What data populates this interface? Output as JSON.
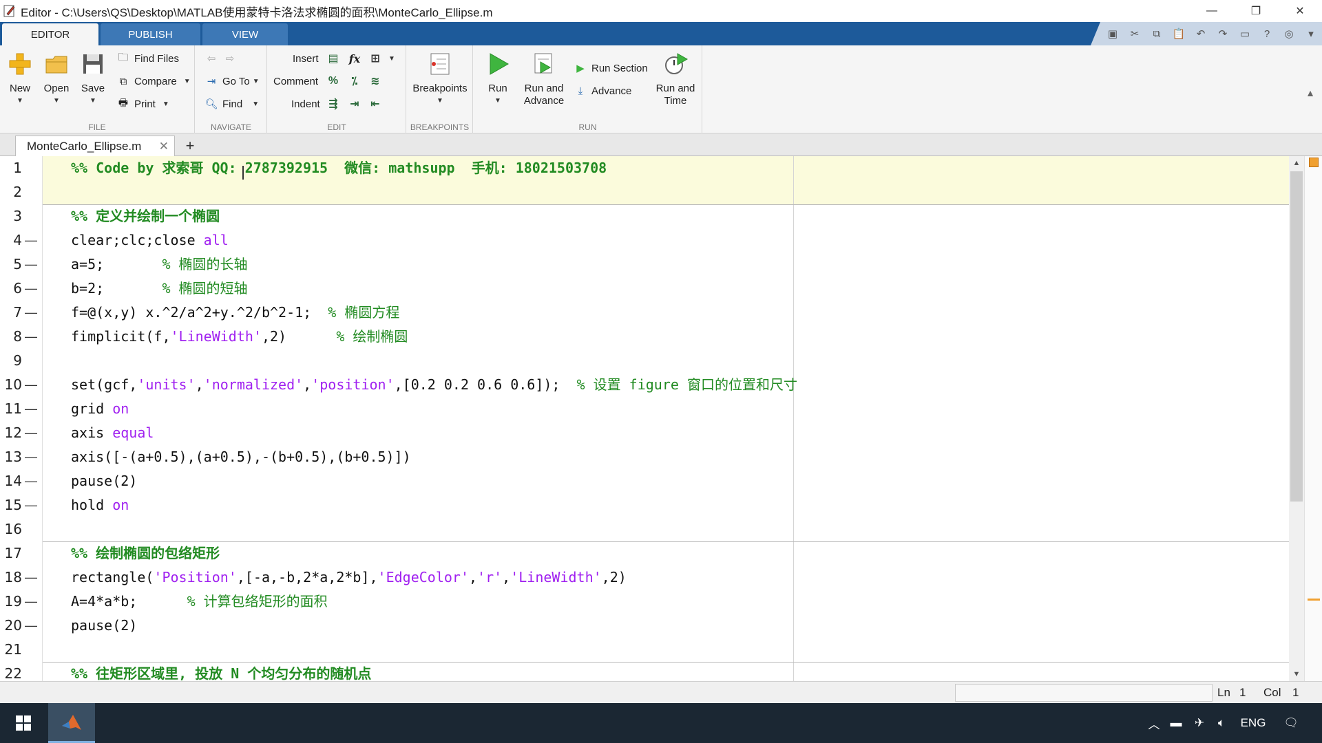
{
  "window": {
    "title": "Editor - C:\\Users\\QS\\Desktop\\MATLAB使用蒙特卡洛法求椭圆的面积\\MonteCarlo_Ellipse.m",
    "minimize": "—",
    "restore": "❐",
    "close": "✕"
  },
  "ribbon_tabs": [
    "EDITOR",
    "PUBLISH",
    "VIEW"
  ],
  "ribbon": {
    "file": {
      "label": "FILE",
      "new": "New",
      "open": "Open",
      "save": "Save",
      "find_files": "Find Files",
      "compare": "Compare",
      "print": "Print"
    },
    "navigate": {
      "label": "NAVIGATE",
      "goto": "Go To",
      "find": "Find"
    },
    "edit": {
      "label": "EDIT",
      "insert": "Insert",
      "comment": "Comment",
      "indent": "Indent",
      "fx": "fx"
    },
    "breakpoints": {
      "label": "BREAKPOINTS",
      "breakpoints": "Breakpoints"
    },
    "run": {
      "label": "RUN",
      "run": "Run",
      "run_and_advance_1": "Run and",
      "run_and_advance_2": "Advance",
      "run_section": "Run Section",
      "advance": "Advance",
      "run_and_time_1": "Run and",
      "run_and_time_2": "Time"
    }
  },
  "document_tab": {
    "name": "MonteCarlo_Ellipse.m",
    "close": "✕",
    "add": "+"
  },
  "code_lines": [
    {
      "n": "1",
      "dash": "",
      "tokens": [
        [
          "sec",
          "%% Code by 求索哥 "
        ],
        [
          "sec",
          "QQ: 2787392915  微信: mathsupp  手机: 18021503708"
        ]
      ]
    },
    {
      "n": "2",
      "dash": "",
      "tokens": []
    },
    {
      "n": "3",
      "dash": "",
      "tokens": [
        [
          "sec",
          "%% 定义并绘制一个椭圆"
        ]
      ]
    },
    {
      "n": "4",
      "dash": "—",
      "tokens": [
        [
          "",
          "clear;clc;close "
        ],
        [
          "str",
          "all"
        ]
      ]
    },
    {
      "n": "5",
      "dash": "—",
      "tokens": [
        [
          "",
          "a=5;       "
        ],
        [
          "cmt",
          "% 椭圆的长轴"
        ]
      ]
    },
    {
      "n": "6",
      "dash": "—",
      "tokens": [
        [
          "",
          "b=2;       "
        ],
        [
          "cmt",
          "% 椭圆的短轴"
        ]
      ]
    },
    {
      "n": "7",
      "dash": "—",
      "tokens": [
        [
          "",
          "f=@(x,y) x.^2/a^2+y.^2/b^2-1;  "
        ],
        [
          "cmt",
          "% 椭圆方程"
        ]
      ]
    },
    {
      "n": "8",
      "dash": "—",
      "tokens": [
        [
          "",
          "fimplicit(f,"
        ],
        [
          "str",
          "'LineWidth'"
        ],
        [
          "",
          ",2)      "
        ],
        [
          "cmt",
          "% 绘制椭圆"
        ]
      ]
    },
    {
      "n": "9",
      "dash": "",
      "tokens": []
    },
    {
      "n": "10",
      "dash": "—",
      "tokens": [
        [
          "",
          "set(gcf,"
        ],
        [
          "str",
          "'units'"
        ],
        [
          "",
          ","
        ],
        [
          "str",
          "'normalized'"
        ],
        [
          "",
          ","
        ],
        [
          "str",
          "'position'"
        ],
        [
          "",
          ",[0.2 0.2 0.6 0.6]);  "
        ],
        [
          "cmt",
          "% 设置 figure 窗口的位置和尺寸"
        ]
      ]
    },
    {
      "n": "11",
      "dash": "—",
      "tokens": [
        [
          "",
          "grid "
        ],
        [
          "str",
          "on"
        ]
      ]
    },
    {
      "n": "12",
      "dash": "—",
      "tokens": [
        [
          "",
          "axis "
        ],
        [
          "str",
          "equal"
        ]
      ]
    },
    {
      "n": "13",
      "dash": "—",
      "tokens": [
        [
          "",
          "axis([-(a+0.5),(a+0.5),-(b+0.5),(b+0.5)])"
        ]
      ]
    },
    {
      "n": "14",
      "dash": "—",
      "tokens": [
        [
          "",
          "pause(2)"
        ]
      ]
    },
    {
      "n": "15",
      "dash": "—",
      "tokens": [
        [
          "",
          "hold "
        ],
        [
          "str",
          "on"
        ]
      ]
    },
    {
      "n": "16",
      "dash": "",
      "tokens": []
    },
    {
      "n": "17",
      "dash": "",
      "tokens": [
        [
          "sec",
          "%% 绘制椭圆的包络矩形"
        ]
      ]
    },
    {
      "n": "18",
      "dash": "—",
      "tokens": [
        [
          "",
          "rectangle("
        ],
        [
          "str",
          "'Position'"
        ],
        [
          "",
          ",[-a,-b,2*a,2*b],"
        ],
        [
          "str",
          "'EdgeColor'"
        ],
        [
          "",
          ","
        ],
        [
          "str",
          "'r'"
        ],
        [
          "",
          ","
        ],
        [
          "str",
          "'LineWidth'"
        ],
        [
          "",
          ",2)"
        ]
      ]
    },
    {
      "n": "19",
      "dash": "—",
      "tokens": [
        [
          "",
          "A=4*a*b;      "
        ],
        [
          "cmt",
          "% 计算包络矩形的面积"
        ]
      ]
    },
    {
      "n": "20",
      "dash": "—",
      "tokens": [
        [
          "",
          "pause(2)"
        ]
      ]
    },
    {
      "n": "21",
      "dash": "",
      "tokens": []
    },
    {
      "n": "22",
      "dash": "",
      "tokens": [
        [
          "sec",
          "%% 往矩形区域里, 投放 N 个均匀分布的随机点"
        ]
      ]
    }
  ],
  "status": {
    "ln_label": "Ln",
    "ln_value": "1",
    "col_label": "Col",
    "col_value": "1"
  },
  "taskbar": {
    "lang": "ENG"
  },
  "colors": {
    "keyword_string": "#a020f0",
    "comment": "#228b22",
    "cell_highlight": "#fbfbdc",
    "tab_strip": "#1d5a9a"
  }
}
